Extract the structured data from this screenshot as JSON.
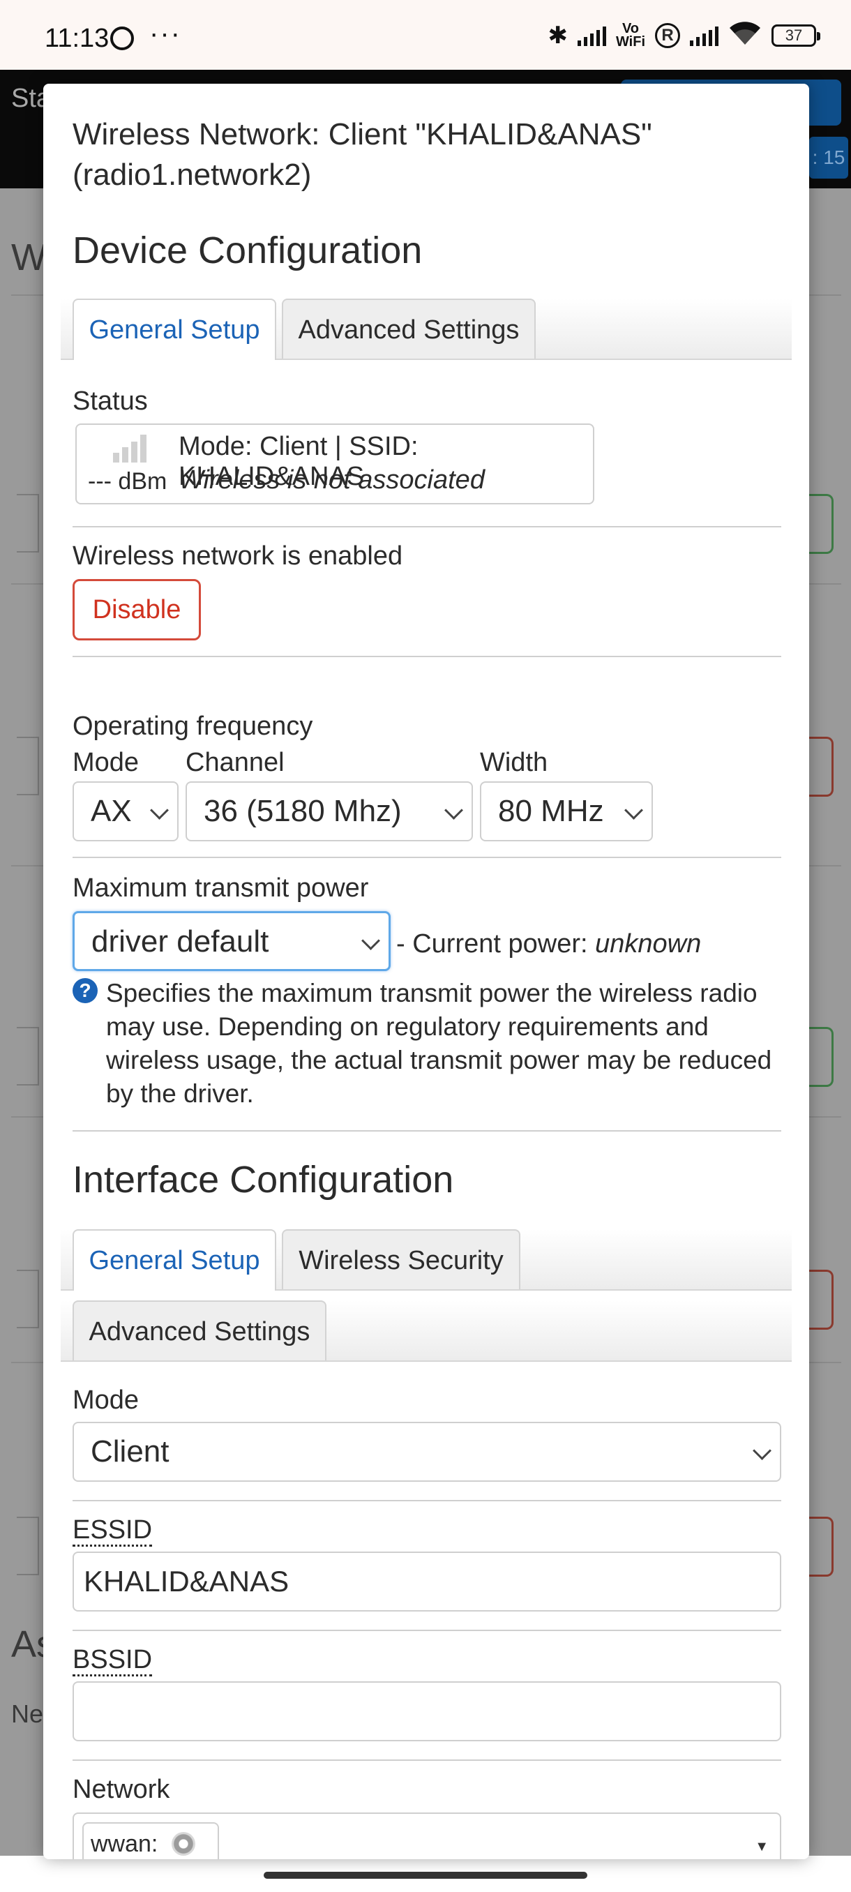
{
  "status_bar": {
    "time": "11:13",
    "dots": "···",
    "vowifi": "Vo\nWiFi",
    "registered": "R",
    "battery": "37",
    "icons": [
      "whatsapp-icon",
      "bluetooth-icon",
      "signal-icon",
      "wifi-icon",
      "battery-icon"
    ]
  },
  "background": {
    "header_text": "Sta",
    "badge": ": 15",
    "heading_w": "W",
    "heading_as": "As",
    "label_ne": "Ne"
  },
  "modal": {
    "title": "Wireless Network: Client \"KHALID&ANAS\" (radio1.network2)",
    "device_config": {
      "heading": "Device Configuration",
      "tabs": [
        {
          "label": "General Setup",
          "active": true
        },
        {
          "label": "Advanced Settings",
          "active": false
        }
      ],
      "status_label": "Status",
      "status_dbm": "--- dBm",
      "status_line1": "Mode: Client | SSID: KHALID&ANAS",
      "status_line2": "Wireless is not associated",
      "enabled_label": "Wireless network is enabled",
      "disable_button": "Disable",
      "op_freq_label": "Operating frequency",
      "mode_label": "Mode",
      "channel_label": "Channel",
      "width_label": "Width",
      "mode_value": "AX",
      "channel_value": "36 (5180 Mhz)",
      "width_value": "80 MHz",
      "tx_power_label": "Maximum transmit power",
      "tx_power_value": "driver default",
      "current_power_prefix": "- Current power: ",
      "current_power_value": "unknown",
      "help_text": "Specifies the maximum transmit power the wireless radio may use. Depending on regulatory requirements and wireless usage, the actual transmit power may be reduced by the driver."
    },
    "interface_config": {
      "heading": "Interface Configuration",
      "tabs": [
        {
          "label": "General Setup",
          "active": true
        },
        {
          "label": "Wireless Security",
          "active": false
        },
        {
          "label": "Advanced Settings",
          "active": false
        }
      ],
      "mode_label": "Mode",
      "mode_value": "Client",
      "essid_label": "ESSID",
      "essid_value": "KHALID&ANAS",
      "bssid_label": "BSSID",
      "bssid_value": "",
      "network_label": "Network",
      "network_chip": "wwan:"
    }
  }
}
